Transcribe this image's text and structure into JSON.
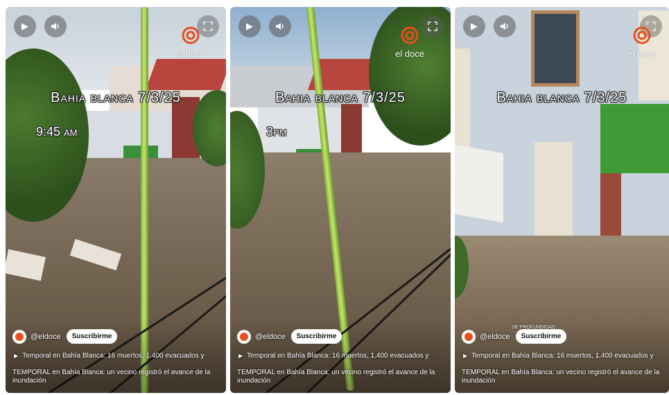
{
  "brand": {
    "logo_text": "el doce",
    "accent": "#e8501d"
  },
  "panels": [
    {
      "title_overlay": "Bahia blanca 7/3/25",
      "time_overlay": "9:45 am",
      "small_overlay": "",
      "channel": "@eldoce",
      "subscribe_label": "Suscribirme",
      "playlist_text": "Temporal en Bahía Blanca: 16 muertos, 1.400 evacuados y",
      "caption": "TEMPORAL en Bahía Blanca: un vecino registró el avance de la inundación",
      "icons": {
        "play": "play-icon",
        "volume": "volume-icon",
        "expand": "expand-icon"
      }
    },
    {
      "title_overlay": "Bahia blanca 7/3/25",
      "time_overlay": "3pm",
      "small_overlay": "",
      "channel": "@eldoce",
      "subscribe_label": "Suscribirme",
      "playlist_text": "Temporal en Bahía Blanca: 16 muertos, 1.400 evacuados y",
      "caption": "TEMPORAL en Bahía Blanca: un vecino registró el avance de la inundación",
      "icons": {
        "play": "play-icon",
        "volume": "volume-icon",
        "expand": "expand-icon"
      }
    },
    {
      "title_overlay": "Bahia blanca 7/3/25",
      "time_overlay": "",
      "small_overlay": "DE PROFUNDIDAD",
      "channel": "@eldoce",
      "subscribe_label": "Suscribirme",
      "playlist_text": "Temporal en Bahía Blanca: 16 muertos, 1.400 evacuados y",
      "caption": "TEMPORAL en Bahía Blanca: un vecino registró el avance de la inundación",
      "icons": {
        "play": "play-icon",
        "volume": "volume-icon",
        "expand": "expand-icon"
      }
    }
  ]
}
